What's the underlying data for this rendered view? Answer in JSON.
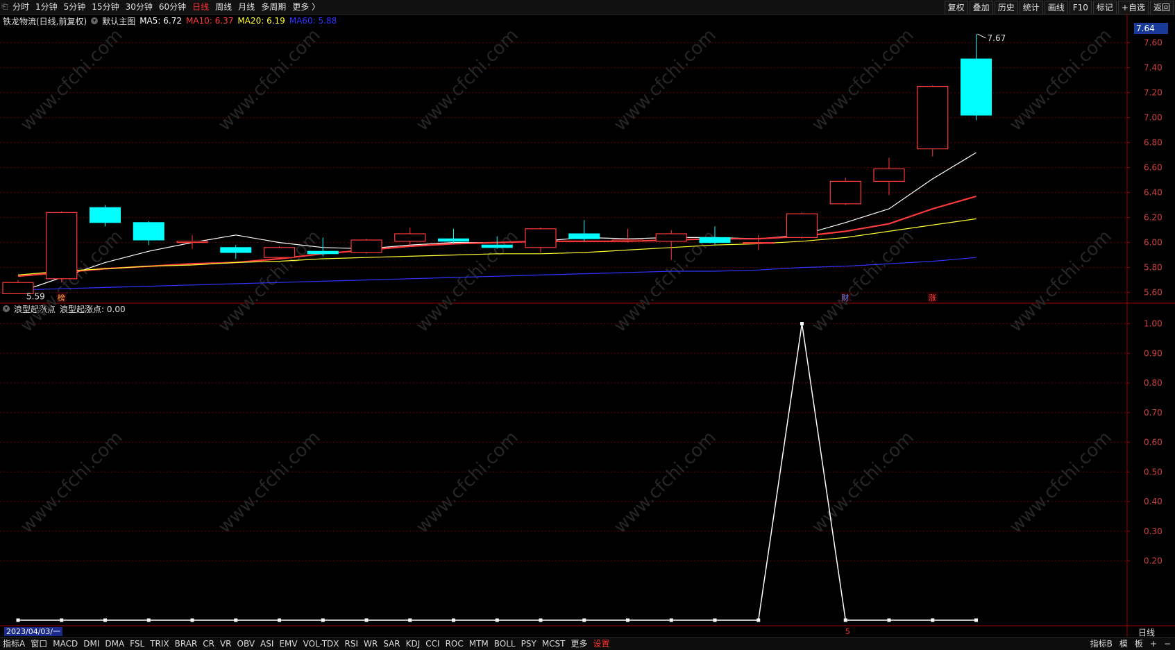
{
  "toolbar": {
    "periods": [
      "分时",
      "1分钟",
      "5分钟",
      "15分钟",
      "30分钟",
      "60分钟",
      "日线",
      "周线",
      "月线",
      "多周期",
      "更多 〉"
    ],
    "active_period": "日线",
    "right_buttons": [
      "复权",
      "叠加",
      "历史",
      "统计",
      "画线",
      "F10",
      "标记",
      "+自选",
      "返回"
    ]
  },
  "main_panel": {
    "stock_name": "铁龙物流(日线,前复权)",
    "main_chart_label": "默认主图",
    "ma5": "MA5: 6.72",
    "ma10": "MA10: 6.37",
    "ma20": "MA20: 6.19",
    "ma60": "MA60: 5.88",
    "current_price": "7.64",
    "high_label": "7.67",
    "low_label": "5.59",
    "markers": [
      "榜",
      "财",
      "涨"
    ],
    "y_ticks": [
      "7.60",
      "7.40",
      "7.20",
      "7.00",
      "6.80",
      "6.60",
      "6.40",
      "6.20",
      "6.00",
      "5.80",
      "5.60"
    ]
  },
  "indicator_panel": {
    "name": "浪型起涨点",
    "value_label": "浪型起涨点: 0.00",
    "y_ticks": [
      "1.00",
      "0.90",
      "0.80",
      "0.70",
      "0.60",
      "0.50",
      "0.40",
      "0.30",
      "0.20"
    ]
  },
  "date_bar": {
    "date": "2023/04/03/一",
    "marker": "5",
    "period_label": "日线"
  },
  "bottom_bar": {
    "items": [
      "指标A",
      "窗口",
      "MACD",
      "DMI",
      "DMA",
      "FSL",
      "TRIX",
      "BRAR",
      "CR",
      "VR",
      "OBV",
      "ASI",
      "EMV",
      "VOL-TDX",
      "RSI",
      "WR",
      "SAR",
      "KDJ",
      "CCI",
      "ROC",
      "MTM",
      "BOLL",
      "PSY",
      "MCST",
      "更多",
      "设置"
    ],
    "right_items": [
      "指标B",
      "模",
      "板",
      "+",
      "−"
    ]
  },
  "colors": {
    "up": "#ff3b3b",
    "down": "#00ffff",
    "ma5": "#ffffff",
    "ma10": "#ff3b3b",
    "ma20": "#ffff33",
    "ma60": "#3333ff",
    "grid": "#8b0000"
  },
  "watermark": "www.cfchi.com",
  "chart_data": [
    {
      "type": "candlestick",
      "title": "铁龙物流(日线,前复权)",
      "ylim": [
        5.52,
        7.72
      ],
      "candles": [
        {
          "o": 5.59,
          "c": 5.68,
          "h": 5.7,
          "l": 5.59,
          "up": true
        },
        {
          "o": 5.71,
          "c": 6.24,
          "h": 6.25,
          "l": 5.68,
          "up": true
        },
        {
          "o": 6.28,
          "c": 6.16,
          "h": 6.3,
          "l": 6.13,
          "up": false
        },
        {
          "o": 6.16,
          "c": 6.02,
          "h": 6.17,
          "l": 5.98,
          "up": false
        },
        {
          "o": 6.0,
          "c": 6.01,
          "h": 6.06,
          "l": 5.95,
          "up": true
        },
        {
          "o": 5.96,
          "c": 5.92,
          "h": 5.98,
          "l": 5.87,
          "up": false
        },
        {
          "o": 5.88,
          "c": 5.96,
          "h": 5.97,
          "l": 5.87,
          "up": true
        },
        {
          "o": 5.93,
          "c": 5.91,
          "h": 6.04,
          "l": 5.89,
          "up": false
        },
        {
          "o": 5.92,
          "c": 6.02,
          "h": 6.03,
          "l": 5.91,
          "up": true
        },
        {
          "o": 6.01,
          "c": 6.07,
          "h": 6.12,
          "l": 5.98,
          "up": true
        },
        {
          "o": 6.03,
          "c": 6.01,
          "h": 6.11,
          "l": 5.99,
          "up": false
        },
        {
          "o": 5.98,
          "c": 5.96,
          "h": 6.05,
          "l": 5.95,
          "up": false
        },
        {
          "o": 5.96,
          "c": 6.11,
          "h": 6.12,
          "l": 5.92,
          "up": true
        },
        {
          "o": 6.07,
          "c": 6.03,
          "h": 6.18,
          "l": 6.01,
          "up": false
        },
        {
          "o": 6.01,
          "c": 6.02,
          "h": 6.11,
          "l": 6.0,
          "up": true
        },
        {
          "o": 6.01,
          "c": 6.07,
          "h": 6.1,
          "l": 5.86,
          "up": true
        },
        {
          "o": 6.04,
          "c": 6.0,
          "h": 6.13,
          "l": 5.98,
          "up": false
        },
        {
          "o": 6.0,
          "c": 6.0,
          "h": 6.06,
          "l": 5.94,
          "up": true
        },
        {
          "o": 6.04,
          "c": 6.23,
          "h": 6.24,
          "l": 6.03,
          "up": true
        },
        {
          "o": 6.31,
          "c": 6.49,
          "h": 6.52,
          "l": 6.3,
          "up": true
        },
        {
          "o": 6.49,
          "c": 6.59,
          "h": 6.68,
          "l": 6.38,
          "up": true
        },
        {
          "o": 6.75,
          "c": 7.25,
          "h": 7.26,
          "l": 6.69,
          "up": true
        },
        {
          "o": 7.47,
          "c": 7.02,
          "h": 7.67,
          "l": 6.98,
          "up": false
        }
      ],
      "ma_lines": [
        {
          "name": "MA5",
          "values": [
            5.6,
            5.72,
            5.84,
            5.93,
            6.0,
            6.06,
            6.0,
            5.96,
            5.95,
            5.98,
            6.0,
            6.0,
            6.01,
            6.04,
            6.03,
            6.04,
            6.04,
            6.03,
            6.06,
            6.16,
            6.27,
            6.51,
            6.72
          ]
        },
        {
          "name": "MA10",
          "values": [
            5.73,
            5.76,
            5.79,
            5.81,
            5.83,
            5.84,
            5.87,
            5.91,
            5.94,
            5.97,
            5.99,
            6.0,
            6.01,
            6.01,
            6.01,
            6.02,
            6.03,
            6.03,
            6.05,
            6.09,
            6.15,
            6.27,
            6.37
          ]
        },
        {
          "name": "MA20",
          "values": [
            5.74,
            5.77,
            5.79,
            5.81,
            5.82,
            5.84,
            5.85,
            5.87,
            5.88,
            5.89,
            5.9,
            5.91,
            5.91,
            5.92,
            5.94,
            5.96,
            5.98,
            5.99,
            6.01,
            6.04,
            6.09,
            6.14,
            6.19
          ]
        },
        {
          "name": "MA60",
          "values": [
            5.62,
            5.63,
            5.64,
            5.65,
            5.66,
            5.67,
            5.68,
            5.69,
            5.7,
            5.71,
            5.72,
            5.73,
            5.74,
            5.75,
            5.76,
            5.77,
            5.77,
            5.78,
            5.8,
            5.81,
            5.83,
            5.85,
            5.88
          ]
        }
      ]
    },
    {
      "type": "line",
      "title": "浪型起涨点",
      "ylim": [
        0.0,
        1.02
      ],
      "values": [
        0,
        0,
        0,
        0,
        0,
        0,
        0,
        0,
        0,
        0,
        0,
        0,
        0,
        0,
        0,
        0,
        0,
        0,
        1,
        0,
        0,
        0,
        0
      ]
    }
  ]
}
